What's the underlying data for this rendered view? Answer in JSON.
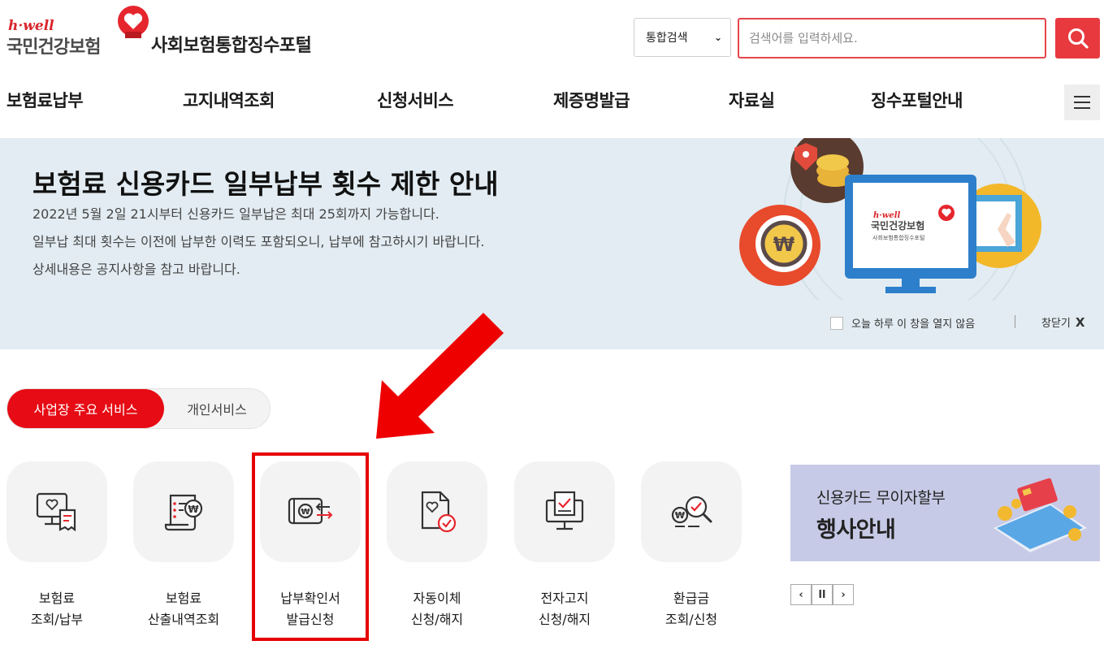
{
  "header": {
    "logo_tagline": "h·well",
    "logo_brand": "국민건강보험",
    "portal_name": "사회보험통합징수포털",
    "search_scope": "통합검색",
    "search_placeholder": "검색어를 입력하세요."
  },
  "nav": {
    "items": [
      {
        "label": "보험료납부"
      },
      {
        "label": "고지내역조회"
      },
      {
        "label": "신청서비스"
      },
      {
        "label": "제증명발급"
      },
      {
        "label": "자료실"
      },
      {
        "label": "징수포털안내"
      }
    ]
  },
  "banner": {
    "title": "보험료 신용카드 일부납부 횟수 제한 안내",
    "lines": [
      "2022년 5월 2일 21시부터 신용카드 일부납은 최대 25회까지 가능합니다.",
      "일부납 최대 횟수는 이전에 납부한 이력도 포함되오니, 납부에 참고하시기 바랍니다.",
      "상세내용은 공지사항을 참고 바랍니다."
    ],
    "art_brand_tagline": "h·well",
    "art_brand": "국민건강보험",
    "art_portal": "사회보험통합징수포털",
    "dont_show_today": "오늘 하루 이 창을 열지 않음",
    "close_label": "창닫기",
    "close_x": "X",
    "colors": {
      "background": "#e2ecf2"
    }
  },
  "tabs": {
    "active": "사업장 주요 서비스",
    "other": "개인서비스"
  },
  "services": [
    {
      "line1": "보험료",
      "line2": "조회/납부",
      "icon": "monitor-receipt-icon"
    },
    {
      "line1": "보험료",
      "line2": "산출내역조회",
      "icon": "calculation-document-icon"
    },
    {
      "line1": "납부확인서",
      "line2": "발급신청",
      "icon": "payment-confirmation-icon"
    },
    {
      "line1": "자동이체",
      "line2": "신청/해지",
      "icon": "auto-transfer-document-icon"
    },
    {
      "line1": "전자고지",
      "line2": "신청/해지",
      "icon": "e-notice-monitor-icon"
    },
    {
      "line1": "환급금",
      "line2": "조회/신청",
      "icon": "refund-search-icon"
    }
  ],
  "promo": {
    "subtitle": "신용카드 무이자할부",
    "title": "행사안내"
  },
  "carousel_controls": {
    "prev": "‹",
    "pause": "ll",
    "next": "›"
  },
  "colors": {
    "accent": "#e60b14",
    "highlight": "#e60000",
    "search_button": "#e8393f",
    "promo_background": "#c7cae6"
  }
}
